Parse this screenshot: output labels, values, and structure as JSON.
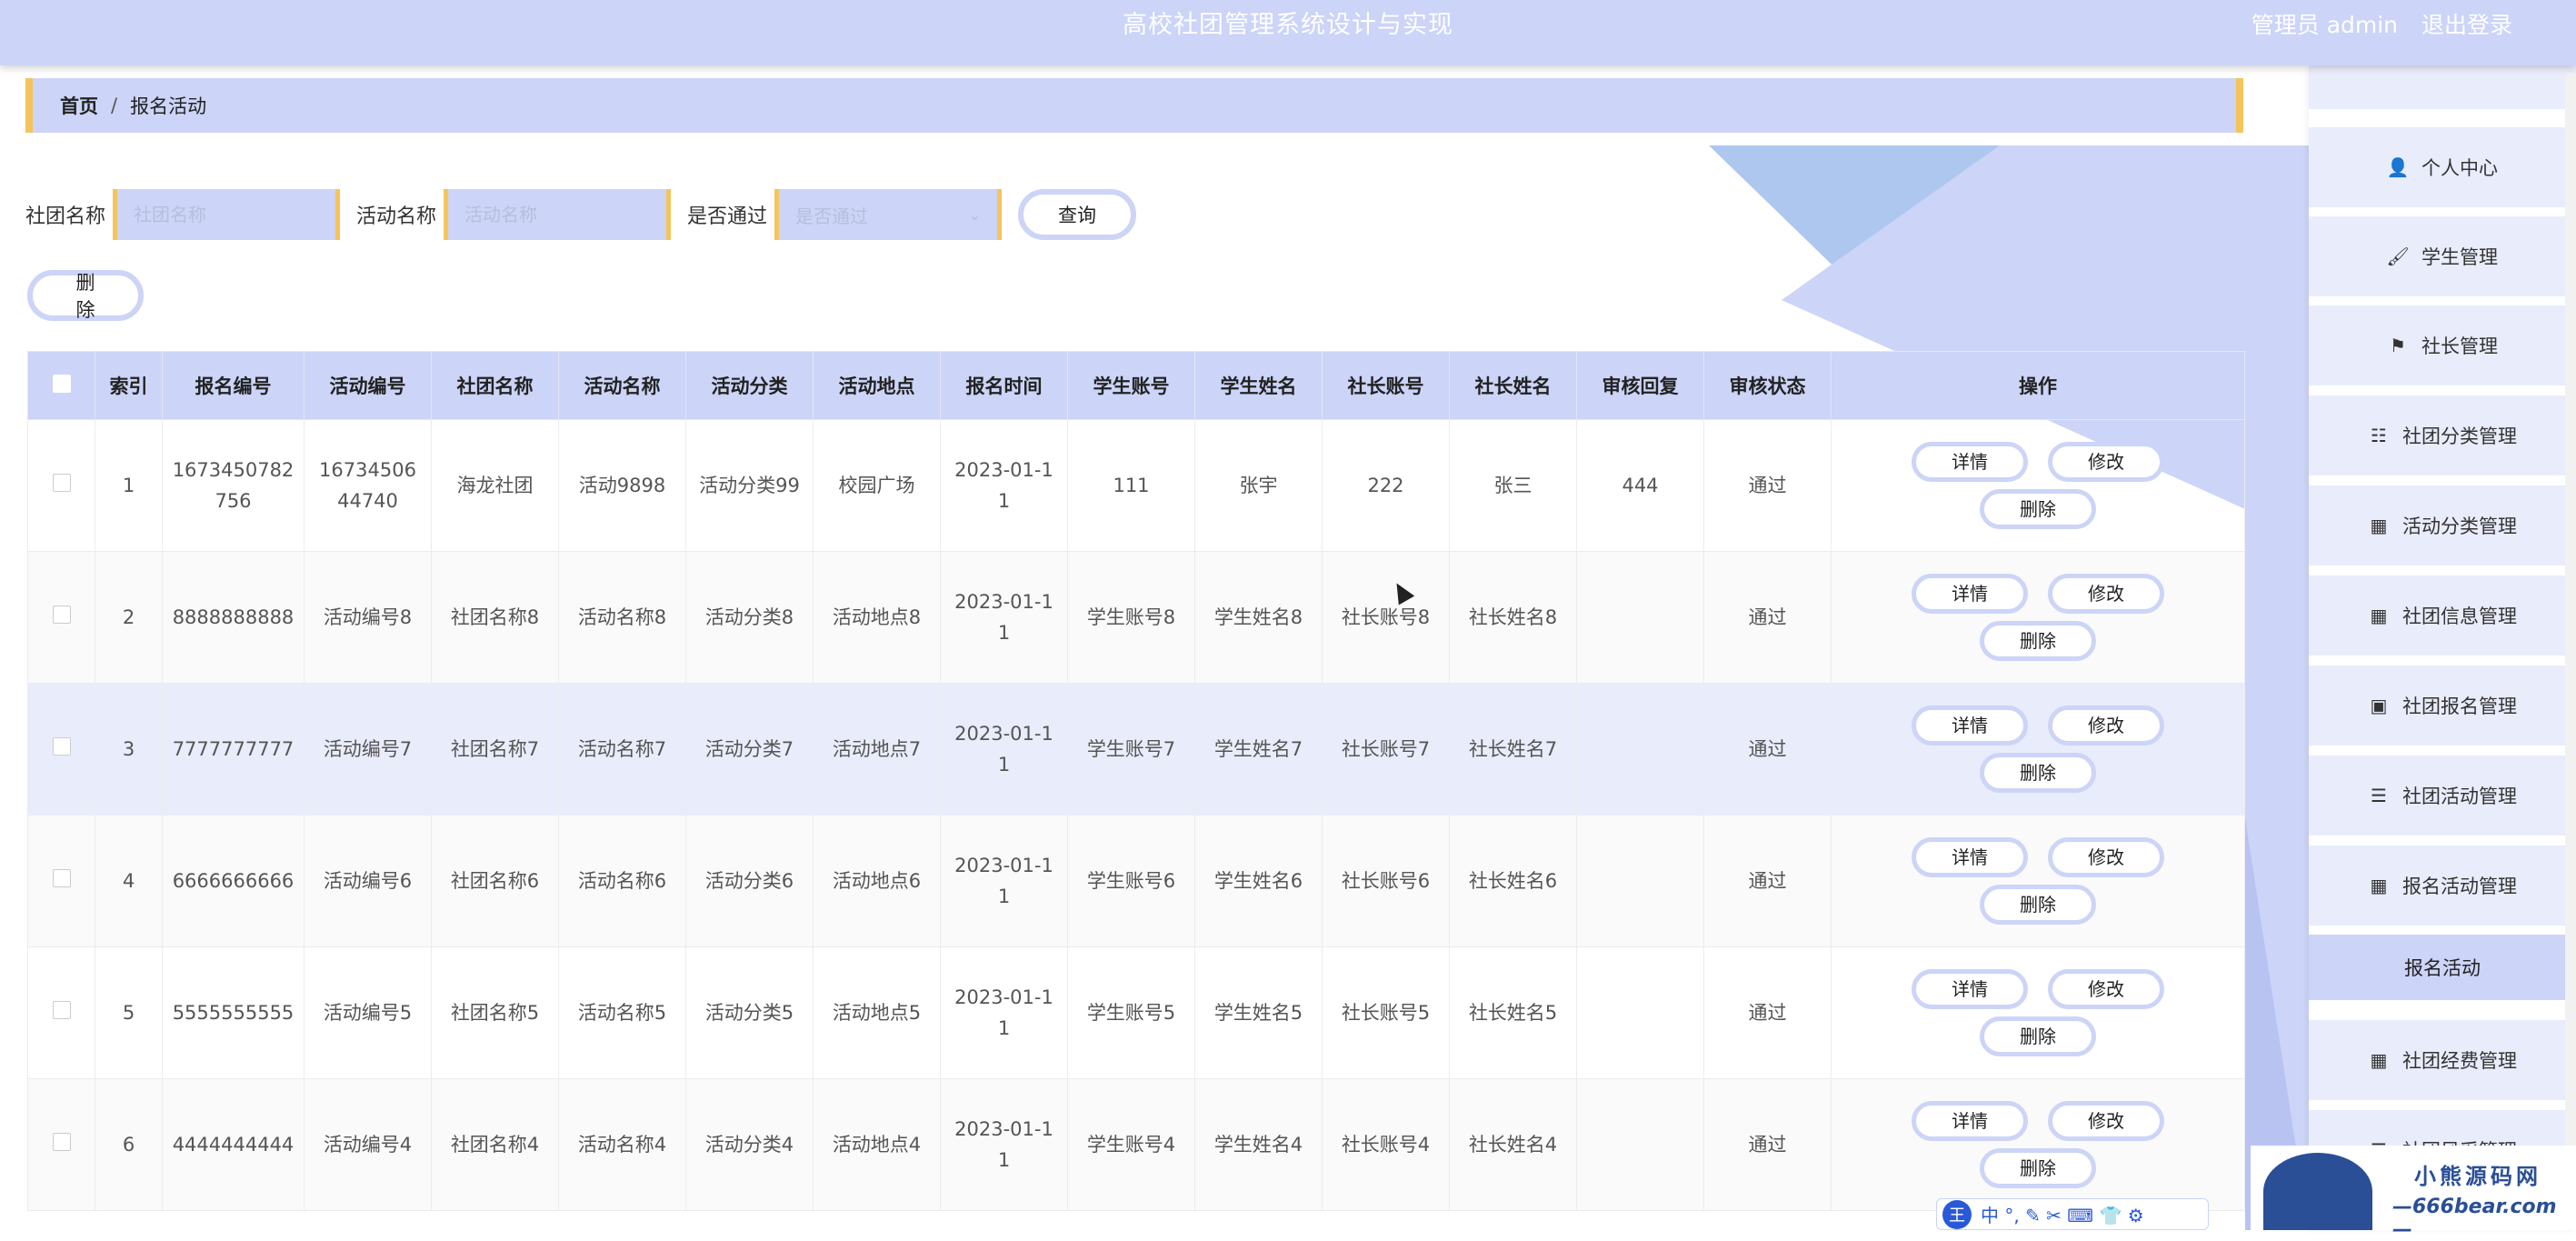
{
  "header": {
    "title": "高校社团管理系统设计与实现",
    "user": "管理员 admin",
    "logout": "退出登录"
  },
  "breadcrumb": {
    "home": "首页",
    "sep": "/",
    "current": "报名活动"
  },
  "search": {
    "club_label": "社团名称",
    "club_placeholder": "社团名称",
    "activity_label": "活动名称",
    "activity_placeholder": "活动名称",
    "pass_label": "是否通过",
    "pass_placeholder": "是否通过",
    "query_button": "查询"
  },
  "actions": {
    "delete": "删除"
  },
  "table": {
    "headers": [
      "索引",
      "报名编号",
      "活动编号",
      "社团名称",
      "活动名称",
      "活动分类",
      "活动地点",
      "报名时间",
      "学生账号",
      "学生姓名",
      "社长账号",
      "社长姓名",
      "审核回复",
      "审核状态",
      "操作"
    ],
    "op_detail": "详情",
    "op_edit": "修改",
    "op_delete": "删除",
    "rows": [
      [
        "1",
        "1673450782756",
        "1673450644740",
        "海龙社团",
        "活动9898",
        "活动分类99",
        "校园广场",
        "2023-01-11",
        "111",
        "张宇",
        "222",
        "张三",
        "444",
        "通过"
      ],
      [
        "2",
        "8888888888",
        "活动编号8",
        "社团名称8",
        "活动名称8",
        "活动分类8",
        "活动地点8",
        "2023-01-11",
        "学生账号8",
        "学生姓名8",
        "社长账号8",
        "社长姓名8",
        "",
        "通过"
      ],
      [
        "3",
        "7777777777",
        "活动编号7",
        "社团名称7",
        "活动名称7",
        "活动分类7",
        "活动地点7",
        "2023-01-11",
        "学生账号7",
        "学生姓名7",
        "社长账号7",
        "社长姓名7",
        "",
        "通过"
      ],
      [
        "4",
        "6666666666",
        "活动编号6",
        "社团名称6",
        "活动名称6",
        "活动分类6",
        "活动地点6",
        "2023-01-11",
        "学生账号6",
        "学生姓名6",
        "社长账号6",
        "社长姓名6",
        "",
        "通过"
      ],
      [
        "5",
        "5555555555",
        "活动编号5",
        "社团名称5",
        "活动名称5",
        "活动分类5",
        "活动地点5",
        "2023-01-11",
        "学生账号5",
        "学生姓名5",
        "社长账号5",
        "社长姓名5",
        "",
        "通过"
      ],
      [
        "6",
        "4444444444",
        "活动编号4",
        "社团名称4",
        "活动名称4",
        "活动分类4",
        "活动地点4",
        "2023-01-11",
        "学生账号4",
        "学生姓名4",
        "社长账号4",
        "社长姓名4",
        "",
        "通过"
      ]
    ]
  },
  "sidebar": {
    "items": [
      {
        "label": "个人中心",
        "icon": "user-icon"
      },
      {
        "label": "学生管理",
        "icon": "brush-icon"
      },
      {
        "label": "社长管理",
        "icon": "flag-icon"
      },
      {
        "label": "社团分类管理",
        "icon": "sliders-icon"
      },
      {
        "label": "活动分类管理",
        "icon": "grid-icon"
      },
      {
        "label": "社团信息管理",
        "icon": "grid-icon"
      },
      {
        "label": "社团报名管理",
        "icon": "clipboard-icon"
      },
      {
        "label": "社团活动管理",
        "icon": "list-icon"
      },
      {
        "label": "报名活动管理",
        "icon": "grid-icon"
      },
      {
        "label": "报名活动",
        "icon": ""
      },
      {
        "label": "社团经费管理",
        "icon": "grid-icon"
      },
      {
        "label": "社团风采管理",
        "icon": "list-icon"
      }
    ]
  },
  "watermark": {
    "name": "小熊源码网",
    "url": "—666bear.com—"
  },
  "ime": {
    "logo": "王",
    "text": "中 °, ✎ ✂ ⌨ 👕 ⚙"
  }
}
